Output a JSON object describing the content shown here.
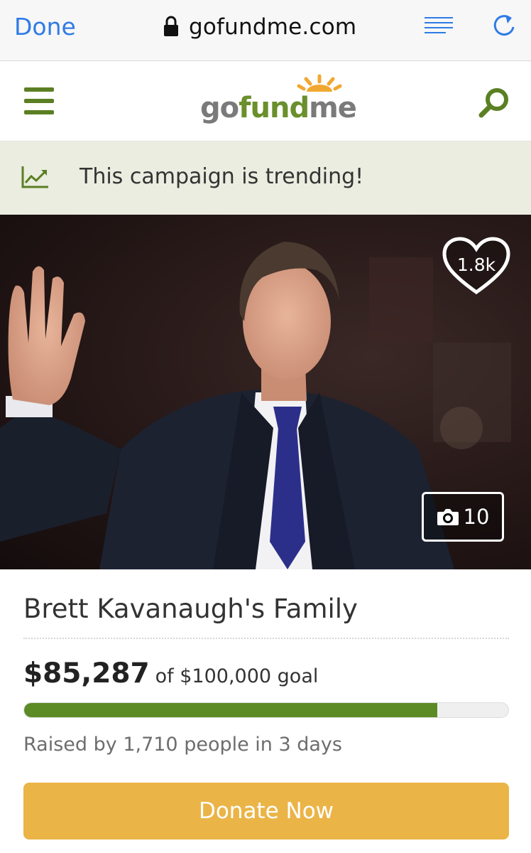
{
  "browser": {
    "done_label": "Done",
    "url": "gofundme.com"
  },
  "header": {
    "logo": {
      "go": "go",
      "fund": "fund",
      "me": "me"
    }
  },
  "banner": {
    "text": "This campaign is trending!"
  },
  "media": {
    "hearts": "1.8k",
    "photo_count": "10"
  },
  "campaign": {
    "title": "Brett Kavanaugh's Family",
    "raised": "$85,287",
    "goal_text": "of $100,000 goal",
    "progress_fraction": 0.85287,
    "raised_by": "Raised by 1,710 people in 3 days",
    "donate_label": "Donate Now"
  },
  "colors": {
    "brand_green": "#5c8a25",
    "donate_orange": "#ebb447",
    "link_blue": "#2f7be6",
    "banner_bg": "#ebede0"
  },
  "icons": [
    "lock-icon",
    "reader-icon",
    "reload-icon",
    "menu-icon",
    "search-icon",
    "trending-chart-icon",
    "heart-icon",
    "camera-icon"
  ]
}
